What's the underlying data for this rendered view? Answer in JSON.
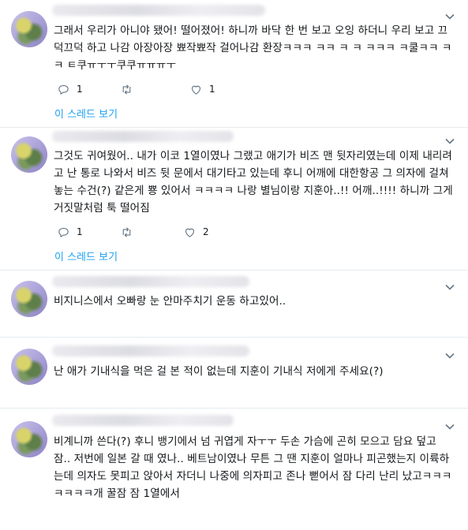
{
  "icons": {
    "reply": "reply-icon",
    "retweet": "retweet-icon",
    "like": "heart-icon",
    "more": "chevron-down-icon"
  },
  "colors": {
    "link": "#1da1f2",
    "border": "#e6ecf0"
  },
  "tweets": [
    {
      "text": "그래서 우리가 아니야 됐어! 떨어졌어! 하니까 바닥 한 번 보고 오잉 하더니 우리 보고 끄덕끄덕 하고 나감 아장아장 뾰작뾰작 걸어나감 환장ㅋㅋㅋ ㅋㅋ ㅋ ㅋ ㅋㅋㅋ ㅋ쿨ㅋㅋ ㅋㅋ ㅌ쿠ㅠㅜㅜ쿠쿠ㅠㅠㅠㅜ",
      "reply_count": "1",
      "retweet_count": "",
      "like_count": "1",
      "thread_link": "이 스레드 보기"
    },
    {
      "text": "그것도 귀여웠어.. 내가 이코 1열이였나 그랬고 애기가 비즈 맨 뒷자리였는데 이제 내리려고 난 통로 나와서 비즈 뒷 문에서 대기타고 있는데 후니 어깨에 대한항공 그 의자에 걸쳐놓는 수건(?) 같은게 뿅 있어서 ㅋㅋㅋㅋ 나랑 별님이랑 지훈아..!! 어깨..!!!! 하니까 그게 거짓말처럼 툭 떨어짐",
      "reply_count": "1",
      "retweet_count": "",
      "like_count": "2",
      "thread_link": "이 스레드 보기"
    },
    {
      "text": "비지니스에서 오빠랑 눈 안마주치기 운동 하고있어..",
      "reply_count": "",
      "retweet_count": "",
      "like_count": ""
    },
    {
      "text": "난 애가 기내식을 먹은 걸 본 적이 없는데 지훈이 기내식 저에게 주세요(?)",
      "reply_count": "",
      "retweet_count": "",
      "like_count": ""
    },
    {
      "text": "비계니까 쓴다(?) 후니 뱅기에서 넘 귀엽게 자ㅜㅜ 두손 가슴에 곤히 모으고 담요 덮고 잠.. 저번에 일본 갈 때 였나.. 베트남이였나 무튼 그 땐 지훈이 얼마나 피곤했는지 이륙하는데 의자도 못피고 앉아서 자더니 나중에 의자피고 존나 뻗어서 잠 다리 난리 났고ㅋㅋㅋㅋㅋㅋㅋ개 꿀잠 잠 1열에서",
      "reply_count": "",
      "retweet_count": "",
      "like_count": ""
    }
  ]
}
